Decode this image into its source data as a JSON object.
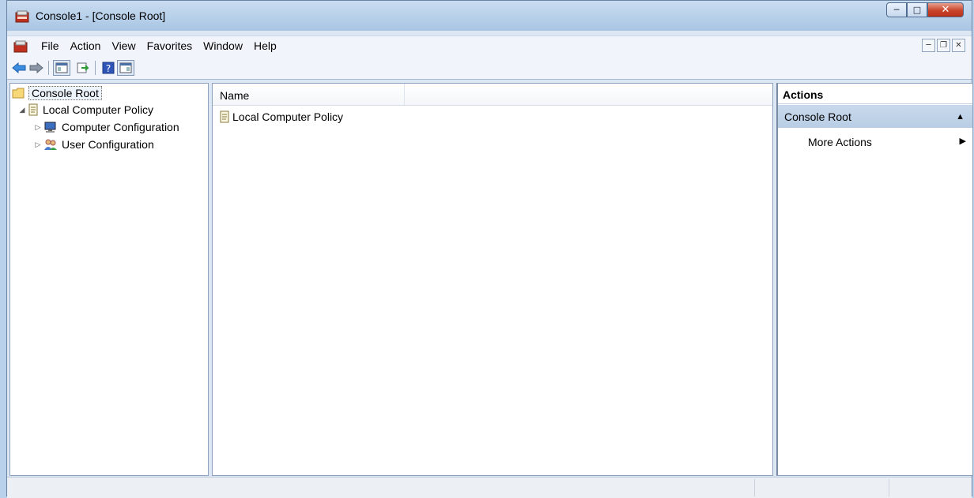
{
  "window": {
    "title": "Console1 - [Console Root]"
  },
  "menu": {
    "items": [
      "File",
      "Action",
      "View",
      "Favorites",
      "Window",
      "Help"
    ]
  },
  "tree": {
    "root": "Console Root",
    "policy": "Local Computer Policy",
    "children": [
      "Computer Configuration",
      "User Configuration"
    ]
  },
  "center": {
    "column_name": "Name",
    "items": [
      "Local Computer Policy"
    ]
  },
  "actions": {
    "header": "Actions",
    "section": "Console Root",
    "more": "More Actions"
  },
  "colors": {
    "accent": "#b8cde4",
    "back_arrow": "#3a8de0",
    "close_red": "#c9442a"
  }
}
